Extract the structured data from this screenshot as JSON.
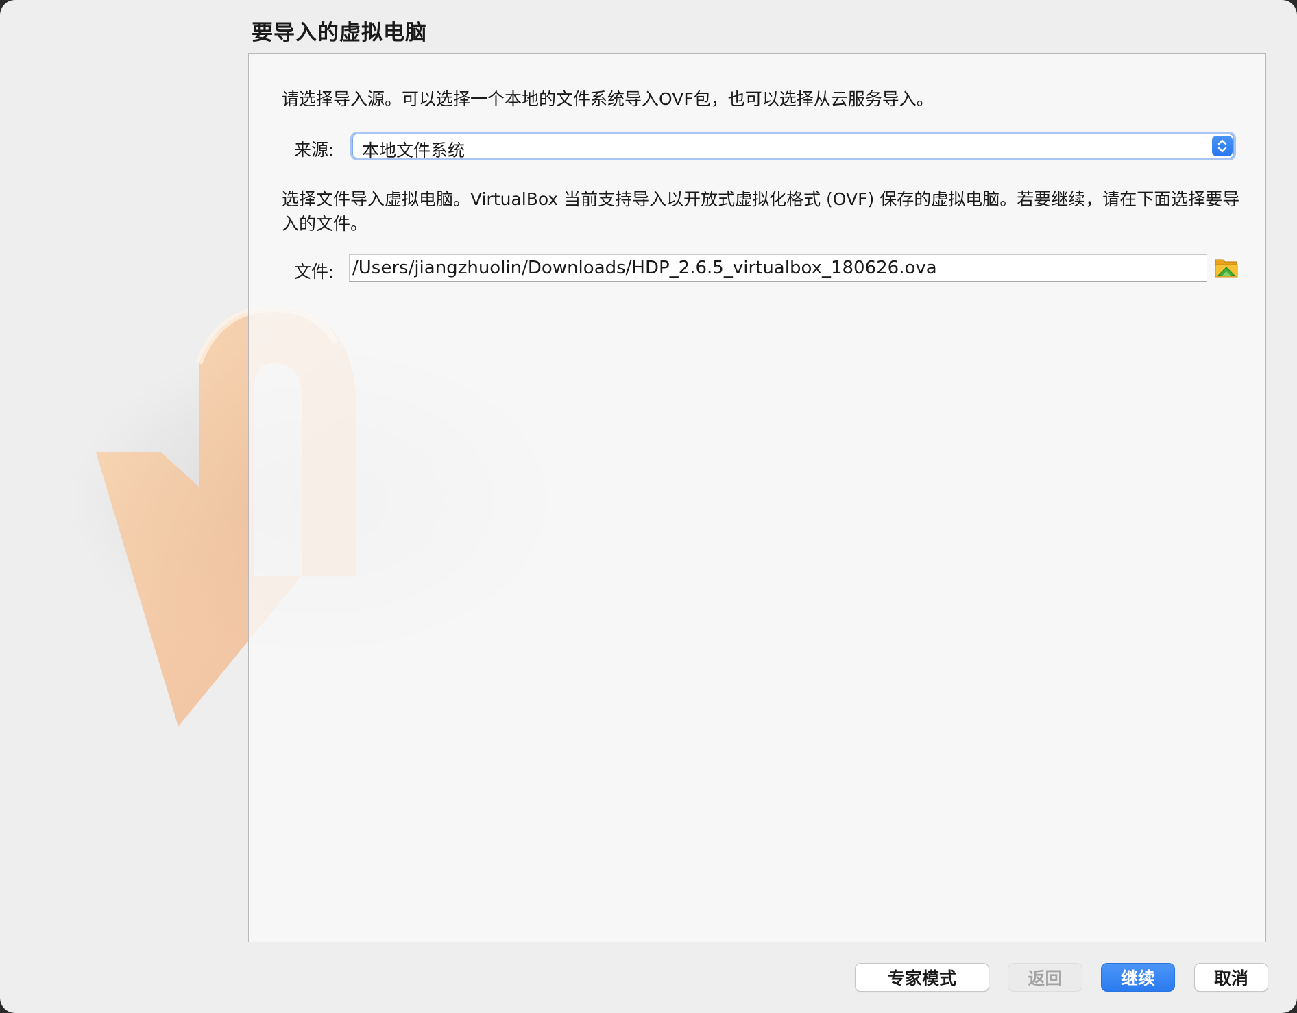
{
  "header": {
    "title": "要导入的虚拟电脑"
  },
  "panel": {
    "intro": "请选择导入源。可以选择一个本地的文件系统导入OVF包，也可以选择从云服务导入。",
    "source": {
      "label": "来源:",
      "value": "本地文件系统"
    },
    "description": "选择文件导入虚拟电脑。VirtualBox 当前支持导入以开放式虚拟化格式 (OVF) 保存的虚拟电脑。若要继续，请在下面选择要导入的文件。",
    "file": {
      "label": "文件:",
      "value": "/Users/jiangzhuolin/Downloads/HDP_2.6.5_virtualbox_180626.ova"
    }
  },
  "buttons": {
    "expert_mode": "专家模式",
    "back": "返回",
    "continue": "继续",
    "cancel": "取消"
  },
  "icons": {
    "select_arrow": "chevron-updown-icon",
    "folder": "folder-open-icon",
    "watermark": "import-arrow-icon"
  },
  "colors": {
    "accent": "#2a7bef",
    "window_bg": "#eeeeee",
    "watermark": "#f3b37a"
  }
}
